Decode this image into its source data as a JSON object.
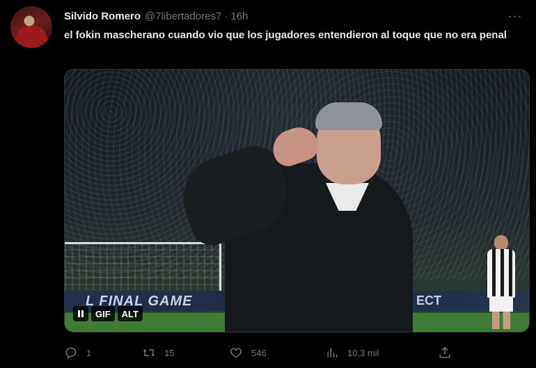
{
  "tweet": {
    "author_name": "Silvido Romero",
    "handle": "@7libertadores7",
    "separator": "·",
    "time": "16h",
    "more": "···",
    "text": "el fokin mascherano cuando vio que los jugadores entendieron al toque que no era penal"
  },
  "media": {
    "board_left_text": "L FINAL GAME",
    "board_right_text": "ECT",
    "gif_badge": "GIF",
    "alt_badge": "ALT"
  },
  "actions": {
    "replies": "1",
    "retweets": "15",
    "likes": "546",
    "views": "10,3 mil"
  },
  "icons": [
    "more-icon",
    "pause-icon",
    "reply-icon",
    "retweet-icon",
    "like-icon",
    "views-icon",
    "share-icon"
  ]
}
